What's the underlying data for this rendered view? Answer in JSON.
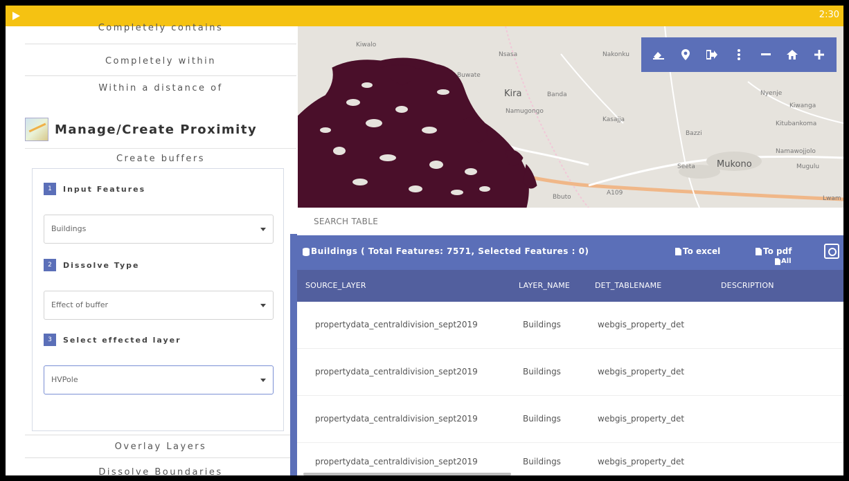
{
  "status_bar": {
    "time": "2:30"
  },
  "left_panel": {
    "menu_items_top": [
      "Completely contains",
      "Completely within",
      "Within a distance of"
    ],
    "section_title": "Manage/Create Proximity",
    "subsection_title": "Create buffers",
    "steps": [
      {
        "num": "1",
        "label": "Input Features",
        "value": "Buildings"
      },
      {
        "num": "2",
        "label": "Dissolve Type",
        "value": "Effect of buffer"
      },
      {
        "num": "3",
        "label": "Select effected layer",
        "value": "HVPole"
      }
    ],
    "menu_items_bottom": [
      "Overlay Layers",
      "Dissolve Boundaries"
    ]
  },
  "map": {
    "labels": [
      "Kiwalo",
      "Nsasa",
      "Nakonku",
      "Buwate",
      "Kira",
      "Banda",
      "Namugongo",
      "Nyenje",
      "Kasajja",
      "Kiwanga",
      "Bazzi",
      "Mukono",
      "Seeta",
      "Kitubankoma",
      "Namawojjolo",
      "Mugulu",
      "Bbuto",
      "A109",
      "Lwam"
    ],
    "tools": [
      "eraser-icon",
      "marker-icon",
      "sign-out-icon",
      "more-icon",
      "zoom-out-icon",
      "home-icon",
      "zoom-in-icon"
    ]
  },
  "search_table_label": "SEARCH TABLE",
  "table": {
    "title": "Buildings ( Total Features: 7571, Selected Features : 0)",
    "export_excel": "To excel",
    "export_pdf": "To pdf",
    "export_all": "All",
    "columns": [
      "SOURCE_LAYER",
      "LAYER_NAME",
      "DET_TABLENAME",
      "DESCRIPTION"
    ],
    "rows": [
      [
        "propertydata_centraldivision_sept2019",
        "Buildings",
        "webgis_property_det",
        ""
      ],
      [
        "propertydata_centraldivision_sept2019",
        "Buildings",
        "webgis_property_det",
        ""
      ],
      [
        "propertydata_centraldivision_sept2019",
        "Buildings",
        "webgis_property_det",
        ""
      ],
      [
        "propertydata_centraldivision_sept2019",
        "Buildings",
        "webgis_property_det",
        ""
      ]
    ]
  },
  "colors": {
    "accent": "#5b6fb8",
    "topbar": "#f5c212",
    "buffer_fill": "#4a0f2a"
  }
}
